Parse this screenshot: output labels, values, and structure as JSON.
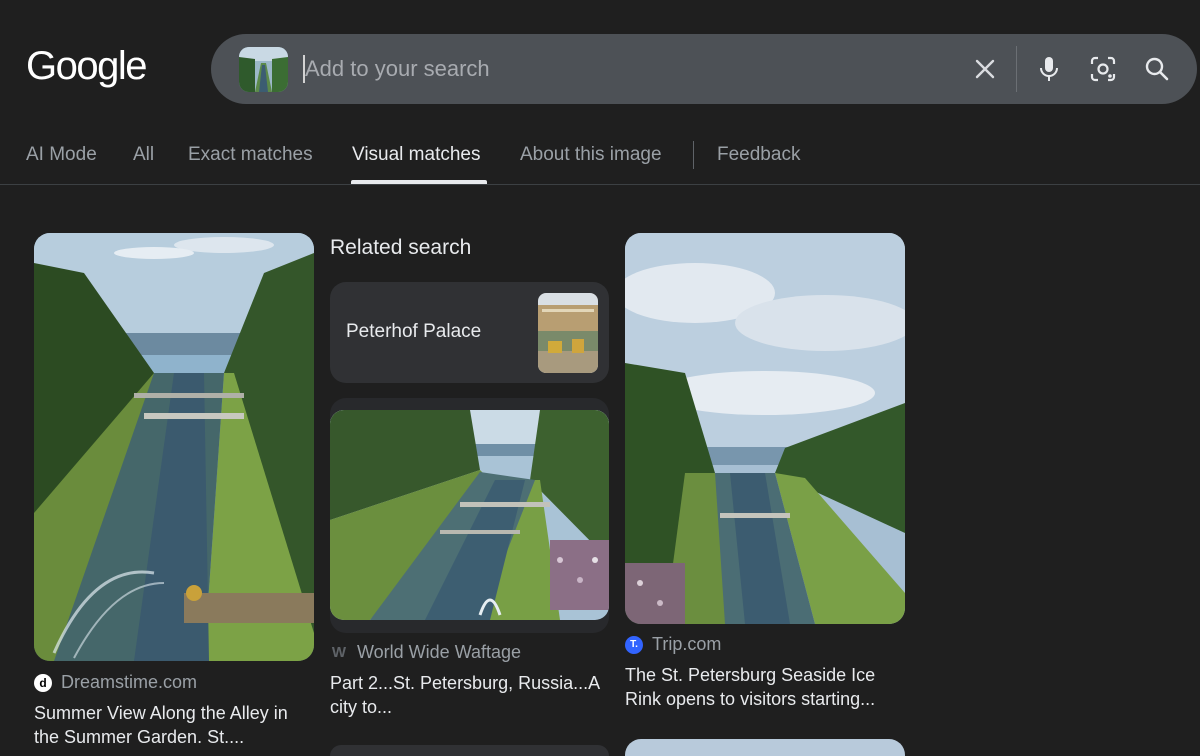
{
  "header": {
    "logo_text": "Google"
  },
  "search": {
    "placeholder": "Add to your search",
    "value": "",
    "icons": [
      "close-icon",
      "microphone-icon",
      "lens-icon",
      "search-icon"
    ]
  },
  "tabs": [
    {
      "label": "AI Mode",
      "active": false
    },
    {
      "label": "All",
      "active": false
    },
    {
      "label": "Exact matches",
      "active": false
    },
    {
      "label": "Visual matches",
      "active": true
    },
    {
      "label": "About this image",
      "active": false
    },
    {
      "label": "Feedback",
      "active": false
    }
  ],
  "related": {
    "title": "Related search",
    "chip_label": "Peterhof Palace"
  },
  "results": [
    {
      "source": "Dreamstime.com",
      "favicon": "d",
      "caption": "Summer View Along the Alley in the Summer Garden. St...."
    },
    {
      "source": "World Wide Waftage",
      "favicon": "W",
      "caption": "Part 2...St. Petersburg, Russia...A city to..."
    },
    {
      "source": "Trip.com",
      "favicon": "T.",
      "caption": "The St. Petersburg Seaside Ice Rink opens to visitors starting..."
    }
  ],
  "colors": {
    "background": "#1f1f1f",
    "searchbar": "#4d5156",
    "chip": "#303134",
    "trip_brand": "#3264ff"
  }
}
